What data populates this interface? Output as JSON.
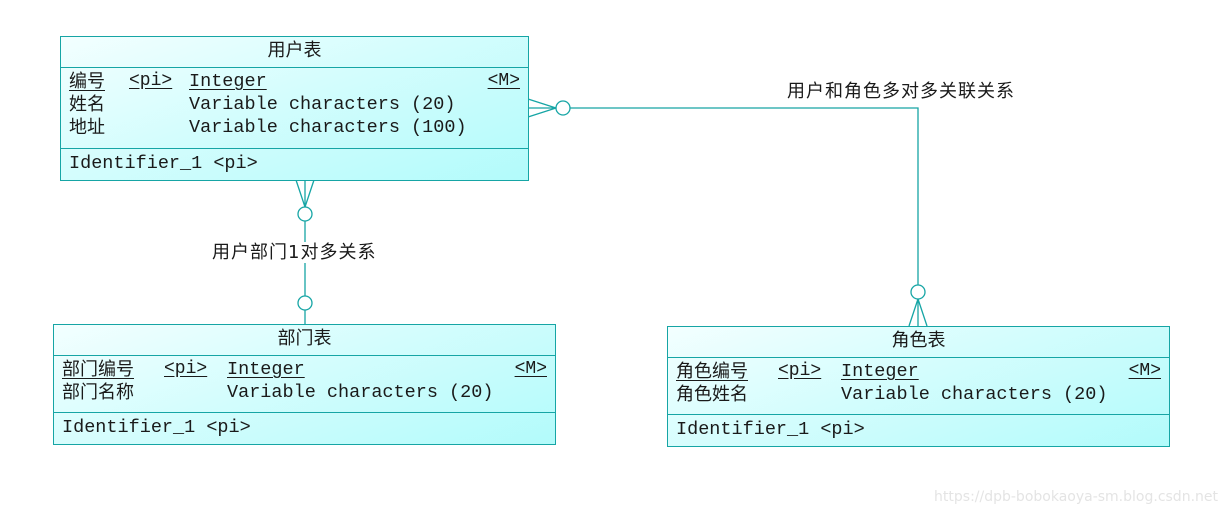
{
  "diagram": {
    "type": "entity-relationship",
    "entities": {
      "user": {
        "title": "用户表",
        "attributes": [
          {
            "name": "编号",
            "pi": "<pi>",
            "type": "Integer",
            "mandatory": "<M>",
            "primary": true
          },
          {
            "name": "姓名",
            "pi": "",
            "type": "Variable characters (20)",
            "mandatory": "",
            "primary": false
          },
          {
            "name": "地址",
            "pi": "",
            "type": "Variable characters (100)",
            "mandatory": "",
            "primary": false
          }
        ],
        "identifier": "Identifier_1 <pi>"
      },
      "department": {
        "title": "部门表",
        "attributes": [
          {
            "name": "部门编号",
            "pi": "<pi>",
            "type": "Integer",
            "mandatory": "<M>",
            "primary": true
          },
          {
            "name": "部门名称",
            "pi": "",
            "type": "Variable characters (20)",
            "mandatory": "",
            "primary": false
          }
        ],
        "identifier": "Identifier_1 <pi>"
      },
      "role": {
        "title": "角色表",
        "attributes": [
          {
            "name": "角色编号",
            "pi": "<pi>",
            "type": "Integer",
            "mandatory": "<M>",
            "primary": true
          },
          {
            "name": "角色姓名",
            "pi": "",
            "type": "Variable characters (20)",
            "mandatory": "",
            "primary": false
          }
        ],
        "identifier": "Identifier_1 <pi>"
      }
    },
    "relationships": [
      {
        "label": "用户部门1对多关系",
        "from": "user",
        "to": "department",
        "from_cardinality": "zero-or-many",
        "to_cardinality": "zero-or-one"
      },
      {
        "label": "用户和角色多对多关联关系",
        "from": "user",
        "to": "role",
        "from_cardinality": "zero-or-many",
        "to_cardinality": "zero-or-many"
      }
    ],
    "colors": {
      "border": "#16a5a5",
      "fill_light": "#f3ffff",
      "fill_dark": "#b2fbfb"
    }
  },
  "watermark": "https://dpb-bobokaoya-sm.blog.csdn.net"
}
